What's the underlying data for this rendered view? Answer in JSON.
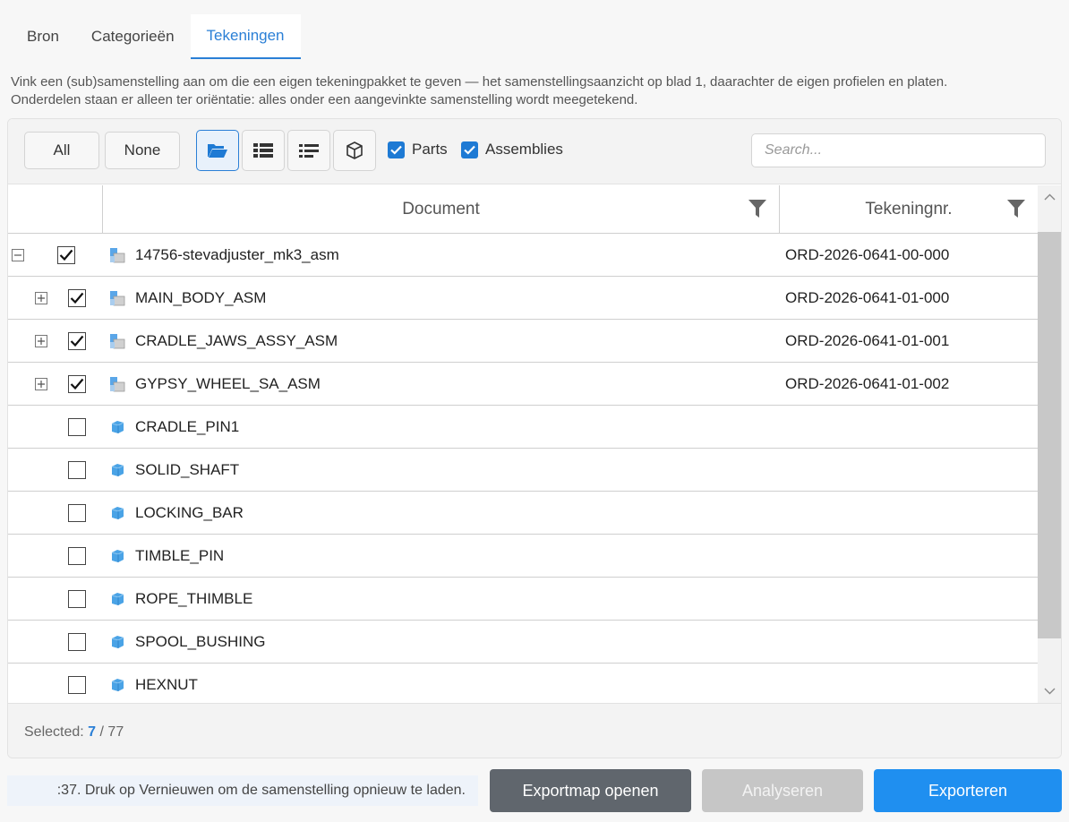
{
  "tabs": [
    {
      "label": "Bron",
      "active": false
    },
    {
      "label": "Categorieën",
      "active": false
    },
    {
      "label": "Tekeningen",
      "active": true
    }
  ],
  "description": {
    "line1": "Vink een (sub)samenstelling aan om die een eigen tekeningpakket te geven — het samenstellingsaanzicht op blad 1, daarachter de eigen profielen en platen.",
    "line2": "Onderdelen staan er alleen ter oriëntatie: alles onder een aangevinkte samenstelling wordt meegetekend."
  },
  "toolbar": {
    "all_label": "All",
    "none_label": "None",
    "view_icons": [
      "folder-open-icon",
      "list-detailed-icon",
      "list-compact-icon",
      "cube-icon"
    ],
    "filter_parts_label": "Parts",
    "filter_parts_checked": true,
    "filter_assemblies_label": "Assemblies",
    "filter_assemblies_checked": true,
    "search_placeholder": "Search..."
  },
  "grid": {
    "columns": {
      "document": "Document",
      "drawing_nr": "Tekeningnr."
    },
    "rows": [
      {
        "name": "14756-stevadjuster_mk3_asm",
        "nr": "ORD-2026-0641-00-000",
        "type": "assembly",
        "checked": true,
        "expander": "minus",
        "level": 0
      },
      {
        "name": "MAIN_BODY_ASM",
        "nr": "ORD-2026-0641-01-000",
        "type": "assembly",
        "checked": true,
        "expander": "plus",
        "level": 1
      },
      {
        "name": "CRADLE_JAWS_ASSY_ASM",
        "nr": "ORD-2026-0641-01-001",
        "type": "assembly",
        "checked": true,
        "expander": "plus",
        "level": 1
      },
      {
        "name": "GYPSY_WHEEL_SA_ASM",
        "nr": "ORD-2026-0641-01-002",
        "type": "assembly",
        "checked": true,
        "expander": "plus",
        "level": 1
      },
      {
        "name": "CRADLE_PIN1",
        "nr": "",
        "type": "part",
        "checked": false,
        "expander": "",
        "level": 1
      },
      {
        "name": "SOLID_SHAFT",
        "nr": "",
        "type": "part",
        "checked": false,
        "expander": "",
        "level": 1
      },
      {
        "name": "LOCKING_BAR",
        "nr": "",
        "type": "part",
        "checked": false,
        "expander": "",
        "level": 1
      },
      {
        "name": "TIMBLE_PIN",
        "nr": "",
        "type": "part",
        "checked": false,
        "expander": "",
        "level": 1
      },
      {
        "name": "ROPE_THIMBLE",
        "nr": "",
        "type": "part",
        "checked": false,
        "expander": "",
        "level": 1
      },
      {
        "name": "SPOOL_BUSHING",
        "nr": "",
        "type": "part",
        "checked": false,
        "expander": "",
        "level": 1
      },
      {
        "name": "HEXNUT",
        "nr": "",
        "type": "part",
        "checked": false,
        "expander": "",
        "level": 1
      }
    ]
  },
  "selection": {
    "label": "Selected:",
    "count": "7",
    "total": "/ 77"
  },
  "status_text": ":37. Druk op Vernieuwen om de samenstelling opnieuw te laden.",
  "actions": {
    "open_folder": "Exportmap openen",
    "analyse": "Analyseren",
    "export": "Exporteren"
  }
}
